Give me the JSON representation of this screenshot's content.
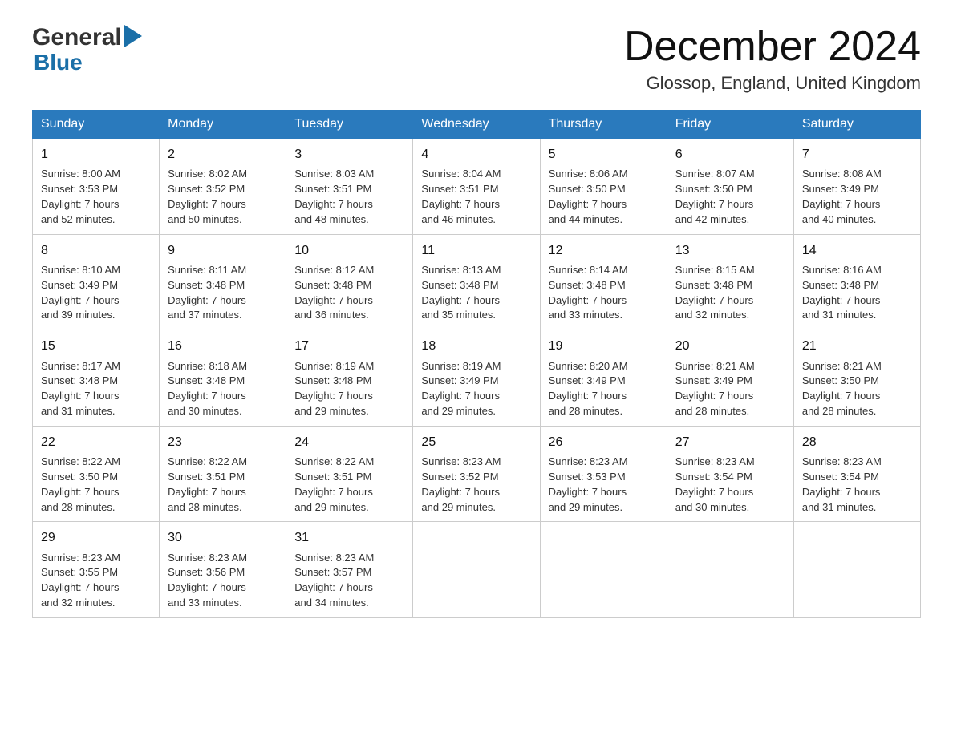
{
  "header": {
    "logo_general": "General",
    "logo_blue": "Blue",
    "month_title": "December 2024",
    "location": "Glossop, England, United Kingdom"
  },
  "weekdays": [
    "Sunday",
    "Monday",
    "Tuesday",
    "Wednesday",
    "Thursday",
    "Friday",
    "Saturday"
  ],
  "weeks": [
    [
      {
        "day": "1",
        "sunrise": "8:00 AM",
        "sunset": "3:53 PM",
        "daylight": "7 hours and 52 minutes."
      },
      {
        "day": "2",
        "sunrise": "8:02 AM",
        "sunset": "3:52 PM",
        "daylight": "7 hours and 50 minutes."
      },
      {
        "day": "3",
        "sunrise": "8:03 AM",
        "sunset": "3:51 PM",
        "daylight": "7 hours and 48 minutes."
      },
      {
        "day": "4",
        "sunrise": "8:04 AM",
        "sunset": "3:51 PM",
        "daylight": "7 hours and 46 minutes."
      },
      {
        "day": "5",
        "sunrise": "8:06 AM",
        "sunset": "3:50 PM",
        "daylight": "7 hours and 44 minutes."
      },
      {
        "day": "6",
        "sunrise": "8:07 AM",
        "sunset": "3:50 PM",
        "daylight": "7 hours and 42 minutes."
      },
      {
        "day": "7",
        "sunrise": "8:08 AM",
        "sunset": "3:49 PM",
        "daylight": "7 hours and 40 minutes."
      }
    ],
    [
      {
        "day": "8",
        "sunrise": "8:10 AM",
        "sunset": "3:49 PM",
        "daylight": "7 hours and 39 minutes."
      },
      {
        "day": "9",
        "sunrise": "8:11 AM",
        "sunset": "3:48 PM",
        "daylight": "7 hours and 37 minutes."
      },
      {
        "day": "10",
        "sunrise": "8:12 AM",
        "sunset": "3:48 PM",
        "daylight": "7 hours and 36 minutes."
      },
      {
        "day": "11",
        "sunrise": "8:13 AM",
        "sunset": "3:48 PM",
        "daylight": "7 hours and 35 minutes."
      },
      {
        "day": "12",
        "sunrise": "8:14 AM",
        "sunset": "3:48 PM",
        "daylight": "7 hours and 33 minutes."
      },
      {
        "day": "13",
        "sunrise": "8:15 AM",
        "sunset": "3:48 PM",
        "daylight": "7 hours and 32 minutes."
      },
      {
        "day": "14",
        "sunrise": "8:16 AM",
        "sunset": "3:48 PM",
        "daylight": "7 hours and 31 minutes."
      }
    ],
    [
      {
        "day": "15",
        "sunrise": "8:17 AM",
        "sunset": "3:48 PM",
        "daylight": "7 hours and 31 minutes."
      },
      {
        "day": "16",
        "sunrise": "8:18 AM",
        "sunset": "3:48 PM",
        "daylight": "7 hours and 30 minutes."
      },
      {
        "day": "17",
        "sunrise": "8:19 AM",
        "sunset": "3:48 PM",
        "daylight": "7 hours and 29 minutes."
      },
      {
        "day": "18",
        "sunrise": "8:19 AM",
        "sunset": "3:49 PM",
        "daylight": "7 hours and 29 minutes."
      },
      {
        "day": "19",
        "sunrise": "8:20 AM",
        "sunset": "3:49 PM",
        "daylight": "7 hours and 28 minutes."
      },
      {
        "day": "20",
        "sunrise": "8:21 AM",
        "sunset": "3:49 PM",
        "daylight": "7 hours and 28 minutes."
      },
      {
        "day": "21",
        "sunrise": "8:21 AM",
        "sunset": "3:50 PM",
        "daylight": "7 hours and 28 minutes."
      }
    ],
    [
      {
        "day": "22",
        "sunrise": "8:22 AM",
        "sunset": "3:50 PM",
        "daylight": "7 hours and 28 minutes."
      },
      {
        "day": "23",
        "sunrise": "8:22 AM",
        "sunset": "3:51 PM",
        "daylight": "7 hours and 28 minutes."
      },
      {
        "day": "24",
        "sunrise": "8:22 AM",
        "sunset": "3:51 PM",
        "daylight": "7 hours and 29 minutes."
      },
      {
        "day": "25",
        "sunrise": "8:23 AM",
        "sunset": "3:52 PM",
        "daylight": "7 hours and 29 minutes."
      },
      {
        "day": "26",
        "sunrise": "8:23 AM",
        "sunset": "3:53 PM",
        "daylight": "7 hours and 29 minutes."
      },
      {
        "day": "27",
        "sunrise": "8:23 AM",
        "sunset": "3:54 PM",
        "daylight": "7 hours and 30 minutes."
      },
      {
        "day": "28",
        "sunrise": "8:23 AM",
        "sunset": "3:54 PM",
        "daylight": "7 hours and 31 minutes."
      }
    ],
    [
      {
        "day": "29",
        "sunrise": "8:23 AM",
        "sunset": "3:55 PM",
        "daylight": "7 hours and 32 minutes."
      },
      {
        "day": "30",
        "sunrise": "8:23 AM",
        "sunset": "3:56 PM",
        "daylight": "7 hours and 33 minutes."
      },
      {
        "day": "31",
        "sunrise": "8:23 AM",
        "sunset": "3:57 PM",
        "daylight": "7 hours and 34 minutes."
      },
      null,
      null,
      null,
      null
    ]
  ],
  "labels": {
    "sunrise": "Sunrise:",
    "sunset": "Sunset:",
    "daylight": "Daylight:"
  }
}
